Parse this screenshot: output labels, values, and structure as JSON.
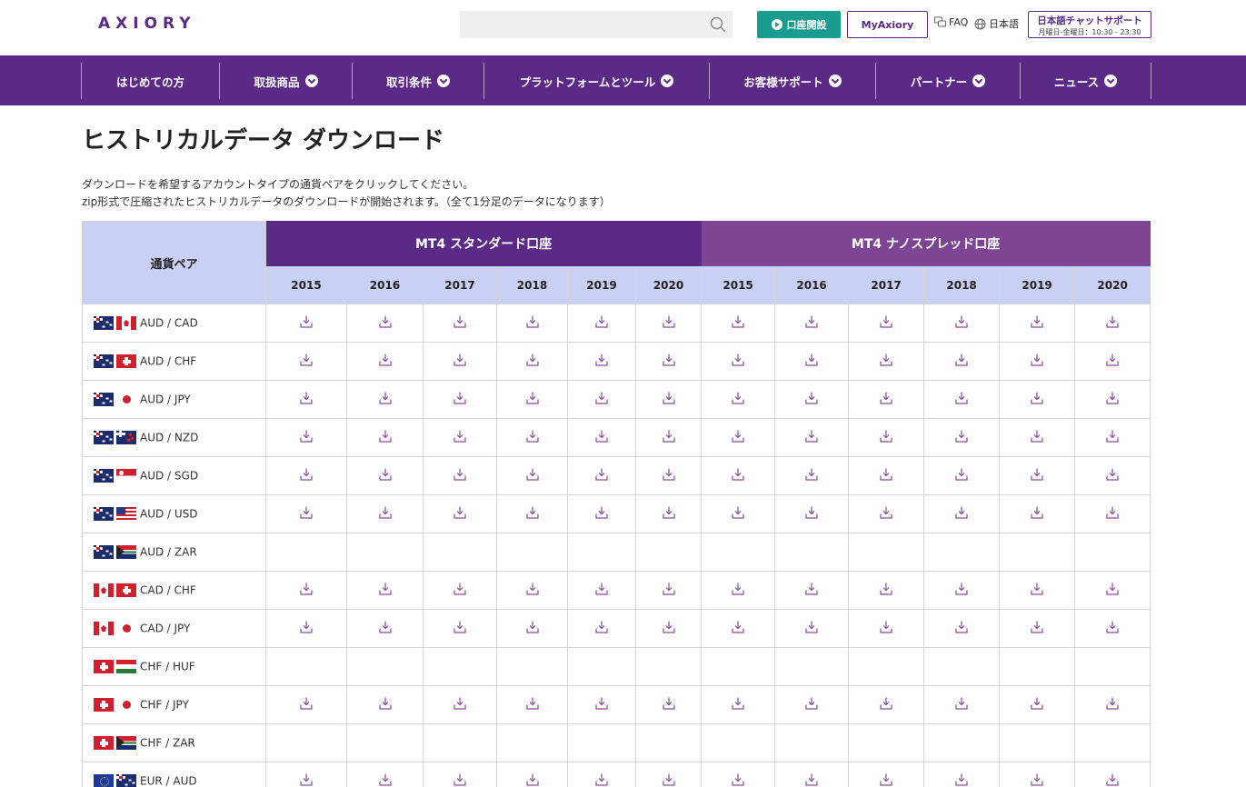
{
  "header": {
    "logo": "AXIORY",
    "search": {
      "placeholder": ""
    },
    "open_account": "口座開設",
    "myaxiory": "MyAxiory",
    "faq": "FAQ",
    "language": "日本語",
    "chat_title": "日本語チャットサポート",
    "chat_hours": "月曜日-金曜日：10:30 - 23:30"
  },
  "nav": {
    "items": [
      {
        "label": "はじめての方",
        "dropdown": false
      },
      {
        "label": "取扱商品",
        "dropdown": true
      },
      {
        "label": "取引条件",
        "dropdown": true
      },
      {
        "label": "プラットフォームとツール",
        "dropdown": true
      },
      {
        "label": "お客様サポート",
        "dropdown": true
      },
      {
        "label": "パートナー",
        "dropdown": true
      },
      {
        "label": "ニュース",
        "dropdown": true
      }
    ]
  },
  "page": {
    "title": "ヒストリカルデータ ダウンロード",
    "intro_line1": "ダウンロードを希望するアカウントタイプの通貨ペアをクリックしてください。",
    "intro_line2": "zip形式で圧縮されたヒストリカルデータのダウンロードが開始されます。（全て1分足のデータになります）"
  },
  "table": {
    "pair_header": "通貨ペア",
    "groups": [
      {
        "label": "MT4 スタンダード口座",
        "years": [
          "2015",
          "2016",
          "2017",
          "2018",
          "2019",
          "2020"
        ]
      },
      {
        "label": "MT4 ナノスプレッド口座",
        "years": [
          "2015",
          "2016",
          "2017",
          "2018",
          "2019",
          "2020"
        ]
      }
    ],
    "rows": [
      {
        "pair": "AUD / CAD",
        "flags": [
          "AUD",
          "CAD"
        ],
        "available": true
      },
      {
        "pair": "AUD / CHF",
        "flags": [
          "AUD",
          "CHF"
        ],
        "available": true
      },
      {
        "pair": "AUD / JPY",
        "flags": [
          "AUD",
          "JPY"
        ],
        "available": true
      },
      {
        "pair": "AUD / NZD",
        "flags": [
          "AUD",
          "NZD"
        ],
        "available": true
      },
      {
        "pair": "AUD / SGD",
        "flags": [
          "AUD",
          "SGD"
        ],
        "available": true
      },
      {
        "pair": "AUD / USD",
        "flags": [
          "AUD",
          "USD"
        ],
        "available": true
      },
      {
        "pair": "AUD / ZAR",
        "flags": [
          "AUD",
          "ZAR"
        ],
        "available": false
      },
      {
        "pair": "CAD / CHF",
        "flags": [
          "CAD",
          "CHF"
        ],
        "available": true
      },
      {
        "pair": "CAD / JPY",
        "flags": [
          "CAD",
          "JPY"
        ],
        "available": true
      },
      {
        "pair": "CHF / HUF",
        "flags": [
          "CHF",
          "HUF"
        ],
        "available": false
      },
      {
        "pair": "CHF / JPY",
        "flags": [
          "CHF",
          "JPY"
        ],
        "available": true
      },
      {
        "pair": "CHF / ZAR",
        "flags": [
          "CHF",
          "ZAR"
        ],
        "available": false
      },
      {
        "pair": "EUR / AUD",
        "flags": [
          "EUR",
          "AUD"
        ],
        "available": true
      }
    ]
  },
  "icons": {
    "search": "search-icon",
    "download": "download-icon",
    "faq": "faq-icon",
    "globe": "globe-icon",
    "play": "play-icon",
    "chevron": "chevron-down-icon"
  },
  "colors": {
    "brand_purple": "#5b2a86",
    "nano_purple": "#7d4593",
    "teal": "#1a9d8f",
    "header_blue": "#c9d0f4",
    "icon_purple": "#8a4a9e"
  }
}
